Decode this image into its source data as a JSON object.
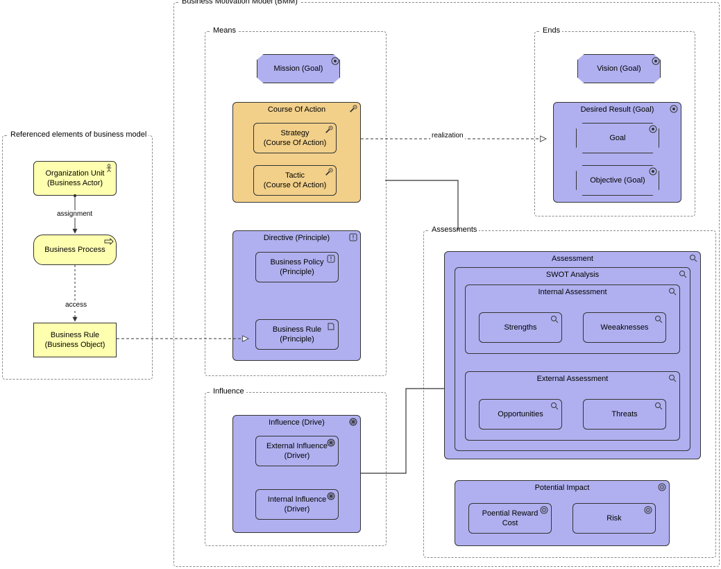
{
  "groups": {
    "referenced": "Referenced elements of business model",
    "bmm": "Business Motivation Model (BMM)",
    "means": "Means",
    "ends": "Ends",
    "assessments": "Assessments",
    "influence": "Influence"
  },
  "nodes": {
    "org_unit": "Organization Unit\n(Business Actor)",
    "business_process": "Business Process",
    "business_rule_obj": "Business Rule\n(Business Object)",
    "mission": "Mission (Goal)",
    "course_of_action": "Course Of Action",
    "strategy": "Strategy\n(Course Of Action)",
    "tactic": "Tactic\n(Course Of Action)",
    "directive": "Directive (Principle)",
    "business_policy": "Business Policy\n(Principle)",
    "business_rule_prin": "Business Rule\n(Principle)",
    "influence_drive": "Influence (Drive)",
    "external_influence": "External Influence\n(Driver)",
    "internal_influence": "Internal Influence\n(Driver)",
    "vision": "Vision (Goal)",
    "desired_result": "Desired Result (Goal)",
    "goal": "Goal",
    "objective": "Objective (Goal)",
    "assessment": "Assessment",
    "swot": "SWOT Analysis",
    "internal_assessment": "Internal Assessment",
    "strengths": "Strengths",
    "weaknesses": "Weeaknesses",
    "external_assessment": "External Assessment",
    "opportunities": "Opportunities",
    "threats": "Threats",
    "potential_impact": "Potential Impact",
    "potential_reward": "Poential Reward\nCost",
    "risk": "Risk"
  },
  "edges": {
    "assignment": "assignment",
    "access": "access",
    "realization": "realization"
  }
}
